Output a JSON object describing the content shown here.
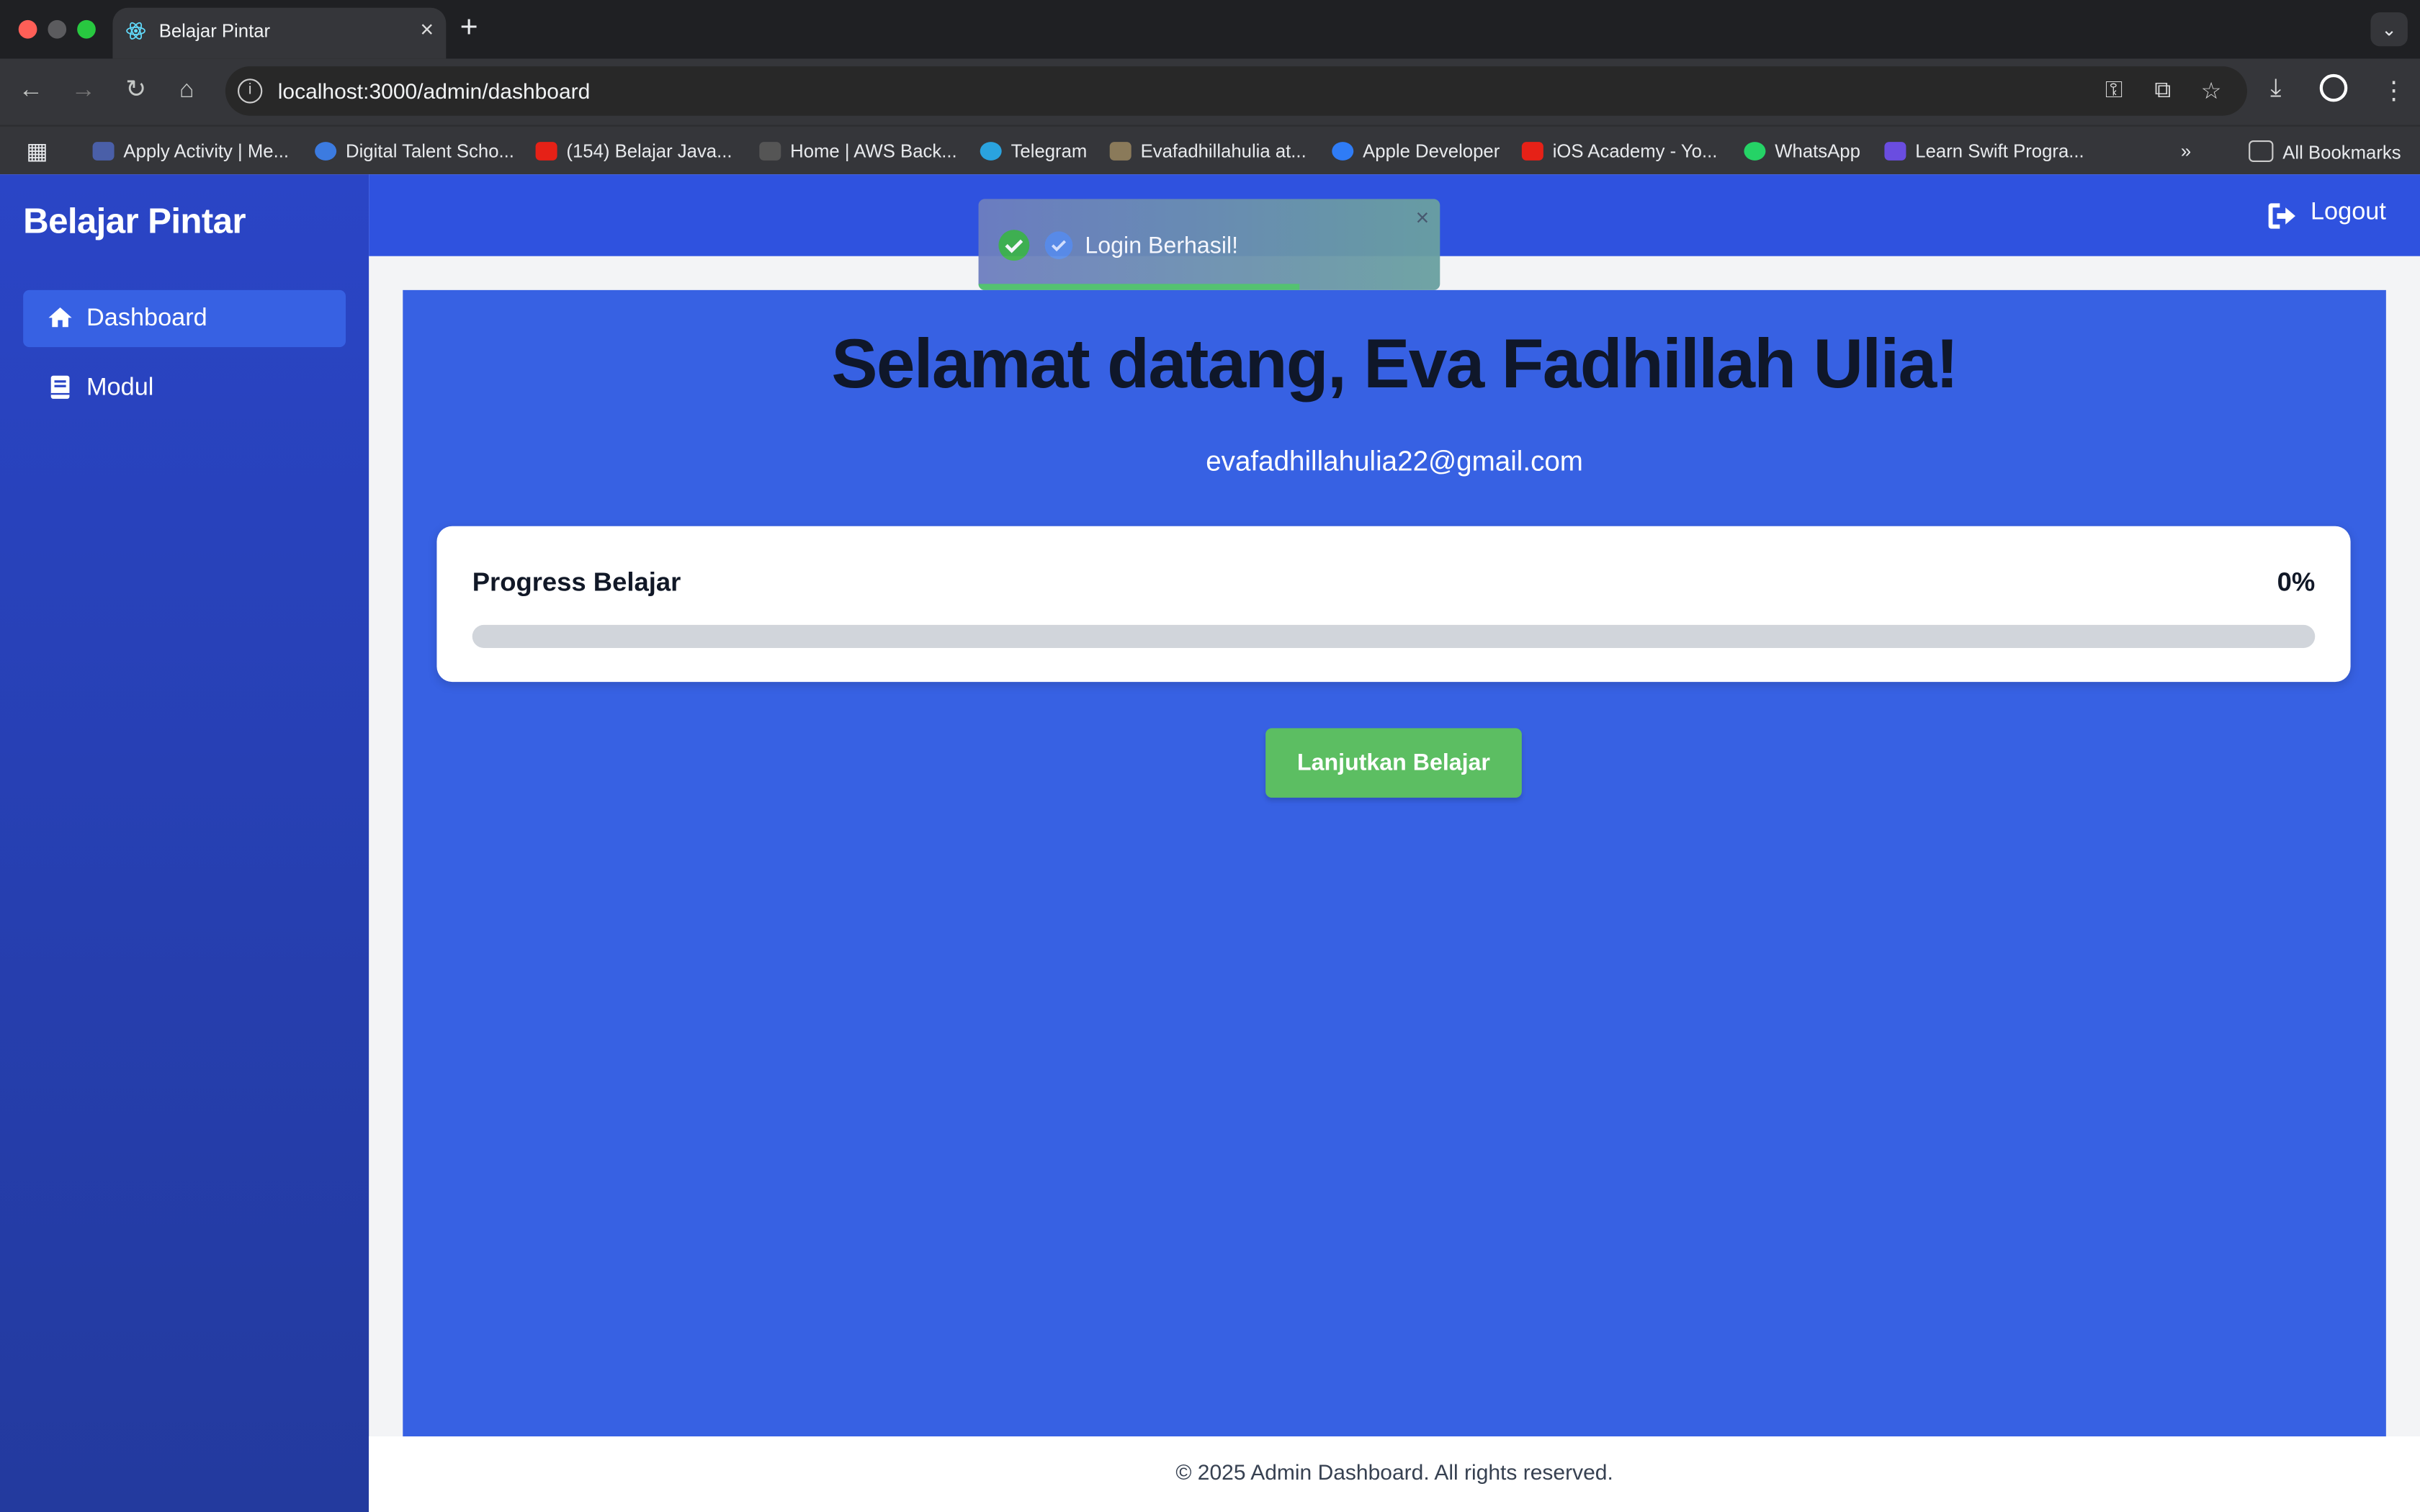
{
  "browser": {
    "tab_title": "Belajar Pintar",
    "url": "localhost:3000/admin/dashboard",
    "bookmarks": [
      "Apply Activity | Me...",
      "Digital Talent Scho...",
      "(154) Belajar Java...",
      "Home | AWS Back...",
      "Telegram",
      "Evafadhillahulia at...",
      "Apple Developer",
      "iOS Academy - Yo...",
      "WhatsApp",
      "Learn Swift Progra..."
    ],
    "all_bookmarks": "All Bookmarks"
  },
  "sidebar": {
    "brand": "Belajar Pintar",
    "items": [
      {
        "label": "Dashboard",
        "icon": "home-icon",
        "active": true
      },
      {
        "label": "Modul",
        "icon": "book-icon",
        "active": false
      }
    ]
  },
  "topbar": {
    "logout_label": "Logout"
  },
  "toast": {
    "message": "Login Berhasil!",
    "close": "×"
  },
  "main": {
    "welcome": "Selamat datang, Eva Fadhillah Ulia!",
    "email": "evafadhillahulia22@gmail.com",
    "progress": {
      "title": "Progress Belajar",
      "percent_label": "0%",
      "value": 0
    },
    "continue_button": "Lanjutkan Belajar"
  },
  "footer": {
    "text": "© 2025 Admin Dashboard. All rights reserved."
  },
  "colors": {
    "sidebar": "#2a45c6",
    "topbar": "#2f52df",
    "content": "#3761e3",
    "button": "#5cbe62",
    "active_nav": "#3761e3"
  }
}
